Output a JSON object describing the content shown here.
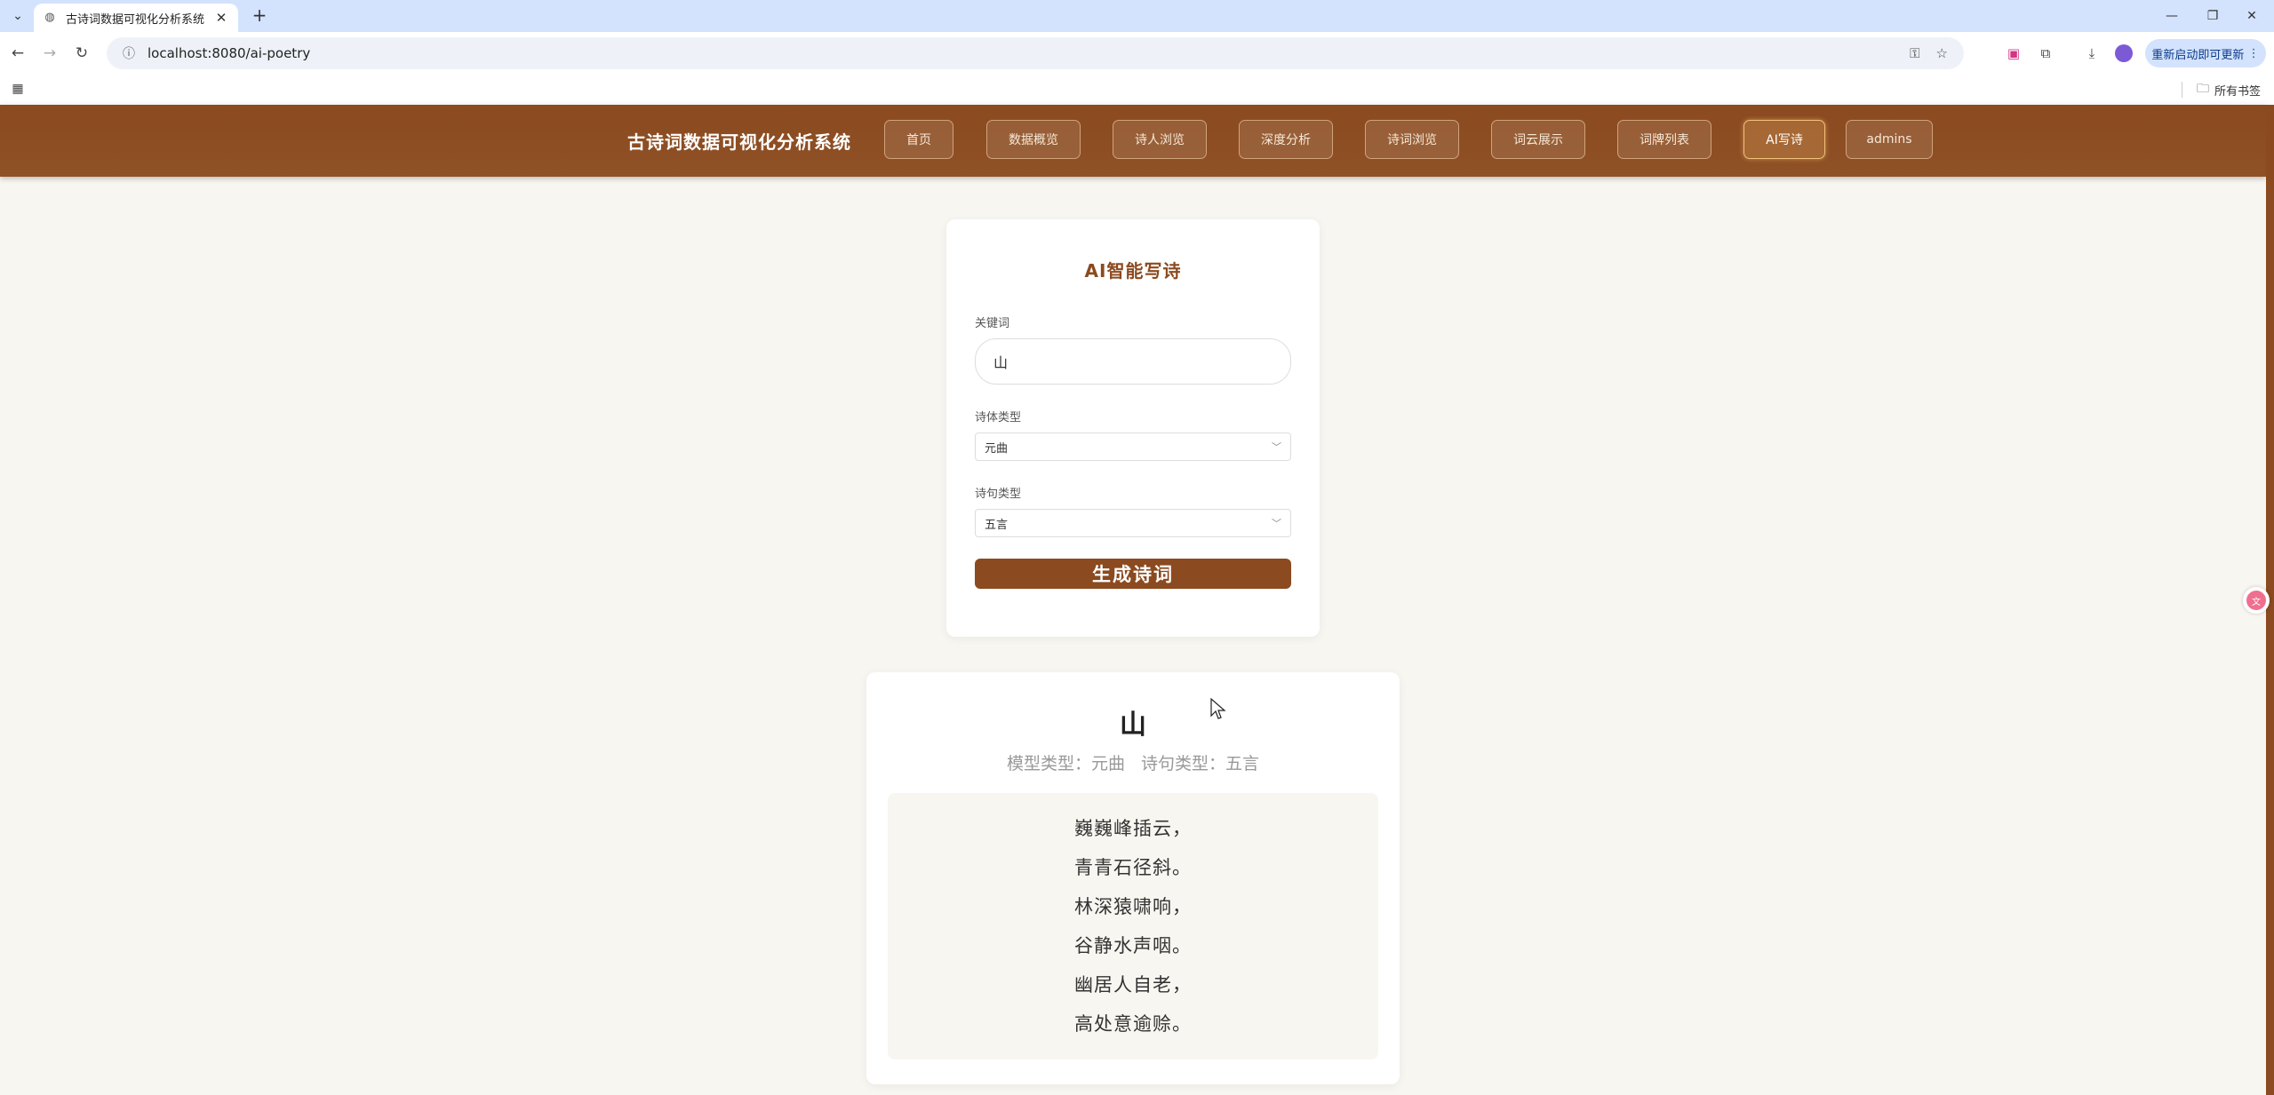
{
  "browser": {
    "tab_title": "古诗词数据可视化分析系统",
    "url": "localhost:8080/ai-poetry",
    "update_label": "重新启动即可更新",
    "bookmarks_folder": "所有书签"
  },
  "header": {
    "app_title": "古诗词数据可视化分析系统",
    "nav": [
      {
        "label": "首页"
      },
      {
        "label": "数据概览"
      },
      {
        "label": "诗人浏览"
      },
      {
        "label": "深度分析"
      },
      {
        "label": "诗词浏览"
      },
      {
        "label": "词云展示"
      },
      {
        "label": "词牌列表"
      },
      {
        "label": "AI写诗",
        "active": true
      },
      {
        "label": "admins"
      }
    ]
  },
  "form": {
    "title": "AI智能写诗",
    "keyword_label": "关键词",
    "keyword_value": "山",
    "style_label": "诗体类型",
    "style_value": "元曲",
    "line_label": "诗句类型",
    "line_value": "五言",
    "submit_label": "生成诗词"
  },
  "result": {
    "title": "山",
    "model_type": "模型类型：元曲",
    "line_type": "诗句类型：五言",
    "lines": [
      "巍巍峰插云，",
      "青青石径斜。",
      "林深猿啸响，",
      "谷静水声咽。",
      "幽居人自老，",
      "高处意逾赊。"
    ]
  },
  "colors": {
    "brand": "#8b4a1f",
    "background": "#f8f6f1",
    "active_border": "#f2c27d"
  }
}
